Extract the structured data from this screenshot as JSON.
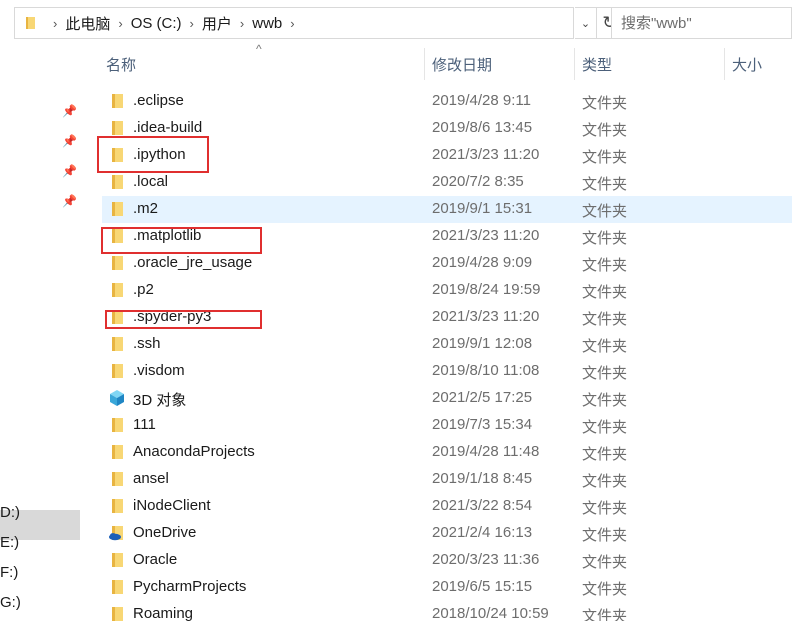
{
  "address_bar": {
    "crumbs": [
      "此电脑",
      "OS (C:)",
      "用户",
      "wwb"
    ],
    "search_placeholder": "搜索\"wwb\""
  },
  "nav_pane": {
    "drives": [
      "D:)",
      "E:)",
      "F:)",
      "G:)"
    ]
  },
  "columns": {
    "name": "名称",
    "date": "修改日期",
    "type": "类型",
    "size": "大小"
  },
  "files": [
    {
      "name": ".eclipse",
      "date": "2019/4/28 9:11",
      "type": "文件夹",
      "icon": "folder-icon"
    },
    {
      "name": ".idea-build",
      "date": "2019/8/6 13:45",
      "type": "文件夹",
      "icon": "folder-icon"
    },
    {
      "name": ".ipython",
      "date": "2021/3/23 11:20",
      "type": "文件夹",
      "icon": "folder-icon"
    },
    {
      "name": ".local",
      "date": "2020/7/2 8:35",
      "type": "文件夹",
      "icon": "folder-icon"
    },
    {
      "name": ".m2",
      "date": "2019/9/1 15:31",
      "type": "文件夹",
      "icon": "folder-icon"
    },
    {
      "name": ".matplotlib",
      "date": "2021/3/23 11:20",
      "type": "文件夹",
      "icon": "folder-icon"
    },
    {
      "name": ".oracle_jre_usage",
      "date": "2019/4/28 9:09",
      "type": "文件夹",
      "icon": "folder-icon"
    },
    {
      "name": ".p2",
      "date": "2019/8/24 19:59",
      "type": "文件夹",
      "icon": "folder-icon"
    },
    {
      "name": ".spyder-py3",
      "date": "2021/3/23 11:20",
      "type": "文件夹",
      "icon": "folder-icon"
    },
    {
      "name": ".ssh",
      "date": "2019/9/1 12:08",
      "type": "文件夹",
      "icon": "folder-icon"
    },
    {
      "name": ".visdom",
      "date": "2019/8/10 11:08",
      "type": "文件夹",
      "icon": "folder-icon"
    },
    {
      "name": "3D 对象",
      "date": "2021/2/5 17:25",
      "type": "文件夹",
      "icon": "3d-objects-icon"
    },
    {
      "name": "111",
      "date": "2019/7/3 15:34",
      "type": "文件夹",
      "icon": "folder-icon"
    },
    {
      "name": "AnacondaProjects",
      "date": "2019/4/28 11:48",
      "type": "文件夹",
      "icon": "folder-icon"
    },
    {
      "name": "ansel",
      "date": "2019/1/18 8:45",
      "type": "文件夹",
      "icon": "folder-icon"
    },
    {
      "name": "iNodeClient",
      "date": "2021/3/22 8:54",
      "type": "文件夹",
      "icon": "folder-icon"
    },
    {
      "name": "OneDrive",
      "date": "2021/2/4 16:13",
      "type": "文件夹",
      "icon": "onedrive-icon"
    },
    {
      "name": "Oracle",
      "date": "2020/3/23 11:36",
      "type": "文件夹",
      "icon": "folder-icon"
    },
    {
      "name": "PycharmProjects",
      "date": "2019/6/5 15:15",
      "type": "文件夹",
      "icon": "folder-icon"
    },
    {
      "name": "Roaming",
      "date": "2018/10/24 10:59",
      "type": "文件夹",
      "icon": "folder-icon"
    }
  ],
  "colors": {
    "folder": "#f8d775",
    "hover_row": "#e5f3ff",
    "annotation": "#e02f2f"
  }
}
